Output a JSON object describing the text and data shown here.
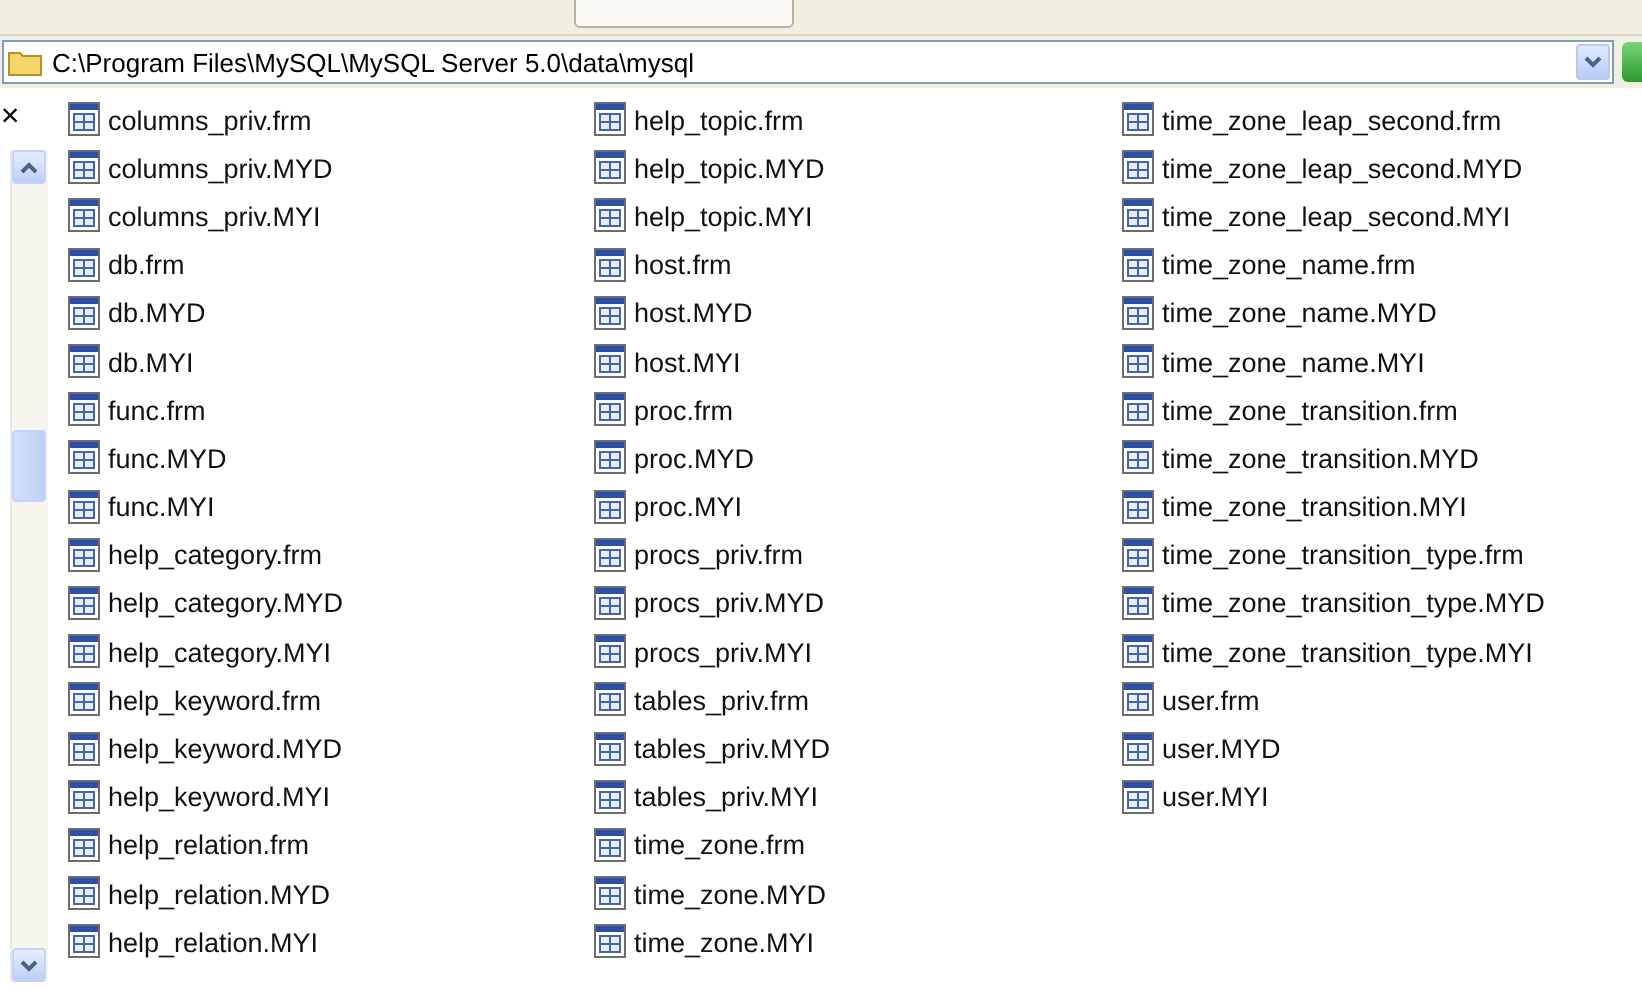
{
  "address_bar": {
    "path": "C:\\Program Files\\MySQL\\MySQL Server 5.0\\data\\mysql"
  },
  "side_pane": {
    "close": "×"
  },
  "files": [
    "columns_priv.frm",
    "columns_priv.MYD",
    "columns_priv.MYI",
    "db.frm",
    "db.MYD",
    "db.MYI",
    "func.frm",
    "func.MYD",
    "func.MYI",
    "help_category.frm",
    "help_category.MYD",
    "help_category.MYI",
    "help_keyword.frm",
    "help_keyword.MYD",
    "help_keyword.MYI",
    "help_relation.frm",
    "help_relation.MYD",
    "help_relation.MYI",
    "help_topic.frm",
    "help_topic.MYD",
    "help_topic.MYI",
    "host.frm",
    "host.MYD",
    "host.MYI",
    "proc.frm",
    "proc.MYD",
    "proc.MYI",
    "procs_priv.frm",
    "procs_priv.MYD",
    "procs_priv.MYI",
    "tables_priv.frm",
    "tables_priv.MYD",
    "tables_priv.MYI",
    "time_zone.frm",
    "time_zone.MYD",
    "time_zone.MYI",
    "time_zone_leap_second.frm",
    "time_zone_leap_second.MYD",
    "time_zone_leap_second.MYI",
    "time_zone_name.frm",
    "time_zone_name.MYD",
    "time_zone_name.MYI",
    "time_zone_transition.frm",
    "time_zone_transition.MYD",
    "time_zone_transition.MYI",
    "time_zone_transition_type.frm",
    "time_zone_transition_type.MYD",
    "time_zone_transition_type.MYI",
    "user.frm",
    "user.MYD",
    "user.MYI"
  ]
}
